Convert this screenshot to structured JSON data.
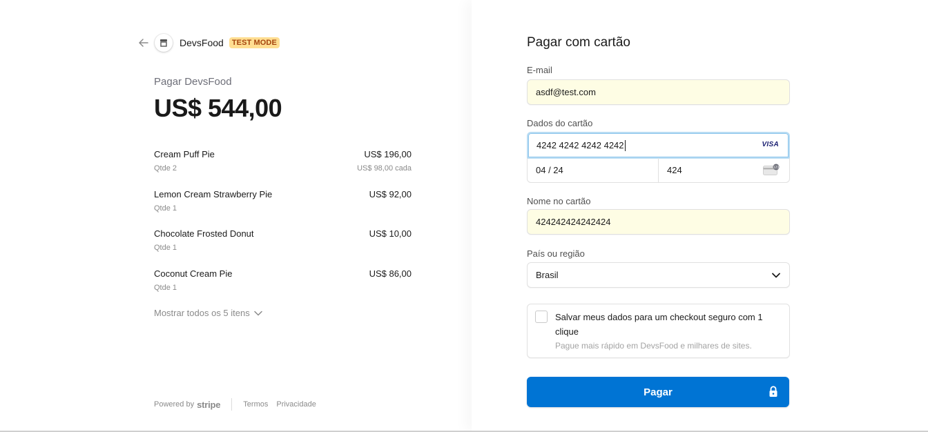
{
  "merchant": {
    "name": "DevsFood",
    "badge": "TEST MODE"
  },
  "summary": {
    "pay_label": "Pagar DevsFood",
    "total": "US$ 544,00",
    "items": [
      {
        "name": "Cream Puff Pie",
        "price": "US$ 196,00",
        "qty": "Qtde 2",
        "each": "US$ 98,00 cada"
      },
      {
        "name": "Lemon Cream Strawberry Pie",
        "price": "US$ 92,00",
        "qty": "Qtde 1",
        "each": ""
      },
      {
        "name": "Chocolate Frosted Donut",
        "price": "US$ 10,00",
        "qty": "Qtde 1",
        "each": ""
      },
      {
        "name": "Coconut Cream Pie",
        "price": "US$ 86,00",
        "qty": "Qtde 1",
        "each": ""
      }
    ],
    "show_all": "Mostrar todos os 5 itens"
  },
  "footer": {
    "powered_by": "Powered by",
    "stripe": "stripe",
    "terms": "Termos",
    "privacy": "Privacidade"
  },
  "form": {
    "title": "Pagar com cartão",
    "email_label": "E-mail",
    "email_value": "asdf@test.com",
    "card_label": "Dados do cartão",
    "card_number": "4242 4242 4242 4242",
    "card_brand": "VISA",
    "expiry": "04 / 24",
    "cvc": "424",
    "name_label": "Nome no cartão",
    "name_value": "424242424242424",
    "country_label": "País ou região",
    "country_value": "Brasil",
    "save_title": "Salvar meus dados para um checkout seguro com 1 clique",
    "save_sub": "Pague mais rápido em DevsFood e milhares de sites.",
    "save_checked": false,
    "pay_button": "Pagar"
  },
  "colors": {
    "accent": "#0074d4",
    "autofill": "#fefde4",
    "badge_bg": "#ffde92",
    "badge_text": "#a5450e"
  }
}
